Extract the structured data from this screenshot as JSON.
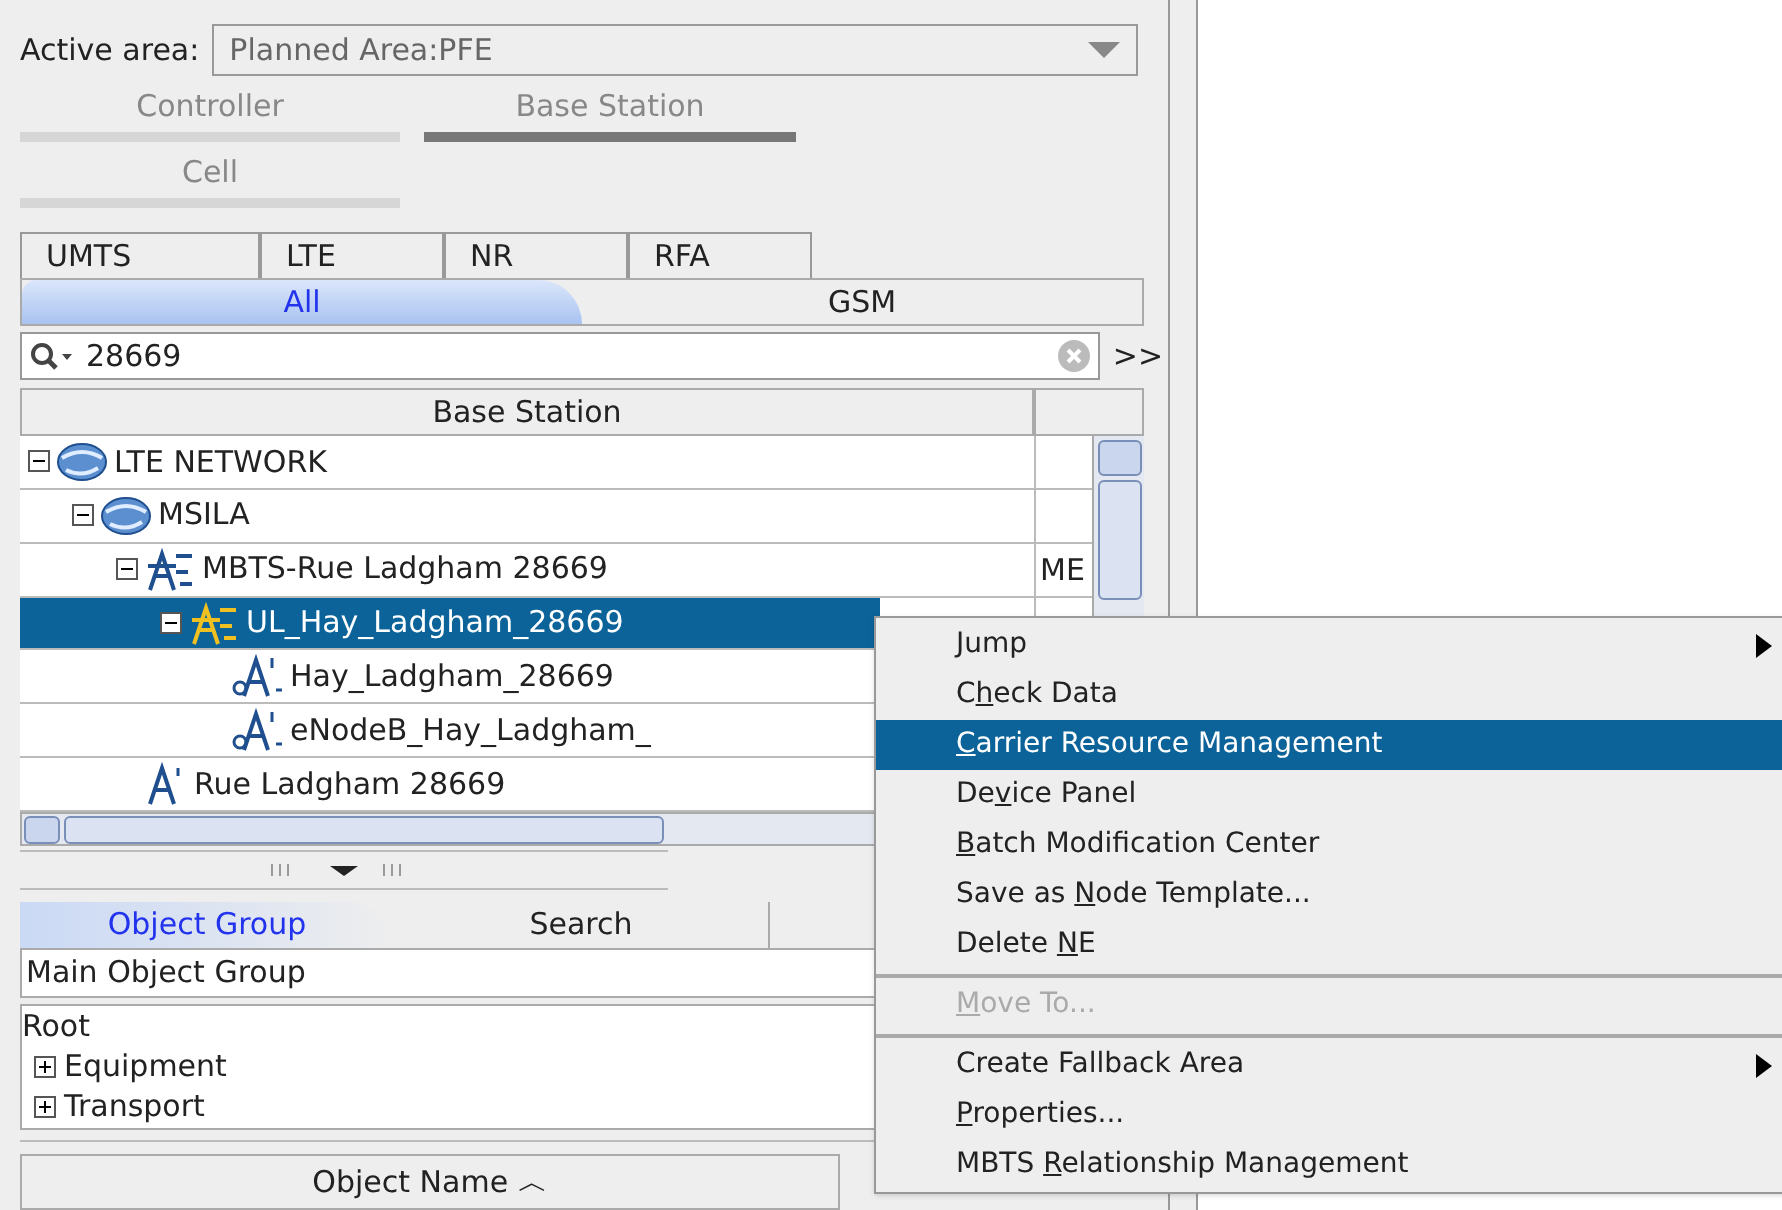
{
  "active_area": {
    "label": "Active area:",
    "value": "Planned Area:PFE"
  },
  "view_tabs": [
    {
      "label": "Controller",
      "selected": false
    },
    {
      "label": "Base Station",
      "selected": true
    },
    {
      "label": "Cell",
      "selected": false
    }
  ],
  "network_tabs": [
    {
      "label": "UMTS"
    },
    {
      "label": "LTE"
    },
    {
      "label": "NR"
    },
    {
      "label": "RFA"
    }
  ],
  "filter_tabs": [
    {
      "label": "All",
      "selected": true
    },
    {
      "label": "GSM",
      "selected": false
    }
  ],
  "search": {
    "value": "28669",
    "more": ">>"
  },
  "table": {
    "columns": [
      "Base Station"
    ],
    "rows": [
      {
        "label": "LTE NETWORK",
        "kind": "network",
        "expanded": true,
        "selected": false,
        "children": [
          {
            "label": "MSILA",
            "kind": "network",
            "expanded": true,
            "selected": false,
            "children": [
              {
                "label": "MBTS-Rue Ladgham 28669",
                "kind": "mbts",
                "expanded": true,
                "selected": false,
                "column_2": "ME",
                "children": [
                  {
                    "label": "UL_Hay_Ladgham_28669",
                    "kind": "mbts",
                    "expanded": true,
                    "selected": true,
                    "children": [
                      {
                        "label": "Hay_Ladgham_28669",
                        "kind": "nodeb",
                        "selected": false
                      },
                      {
                        "label": "eNodeB_Hay_Ladgham_",
                        "kind": "nodeb",
                        "selected": false
                      }
                    ]
                  }
                ]
              },
              {
                "label": "Rue Ladgham 28669",
                "kind": "station",
                "selected": false
              }
            ]
          }
        ]
      }
    ]
  },
  "group_tabs": [
    {
      "label": "Object Group",
      "selected": true
    },
    {
      "label": "Search",
      "selected": false
    }
  ],
  "group_field": {
    "value": "Main Object Group"
  },
  "group_tree": {
    "label": "Root",
    "children": [
      {
        "label": "Equipment",
        "expanded": false
      },
      {
        "label": "Transport",
        "expanded": false
      }
    ]
  },
  "object_table": {
    "columns": [
      "Object Name ︿"
    ]
  },
  "context_menu": [
    {
      "kind": "item",
      "pre": "Jump",
      "selected": false,
      "disabled": false,
      "submenu": true
    },
    {
      "kind": "item",
      "pre": "C",
      "key": "h",
      "post": "eck Data",
      "selected": false,
      "disabled": false,
      "submenu": false
    },
    {
      "kind": "item",
      "key": "C",
      "post": "arrier Resource Management",
      "selected": true,
      "disabled": false,
      "submenu": false
    },
    {
      "kind": "item",
      "pre": "De",
      "key": "v",
      "post": "ice Panel",
      "selected": false,
      "disabled": false,
      "submenu": false
    },
    {
      "kind": "item",
      "key": "B",
      "post": "atch Modification Center",
      "selected": false,
      "disabled": false,
      "submenu": false
    },
    {
      "kind": "item",
      "pre": "Save as ",
      "key": "N",
      "post": "ode Template...",
      "selected": false,
      "disabled": false,
      "submenu": false
    },
    {
      "kind": "item",
      "pre": "Delete ",
      "key": "N",
      "post": "E",
      "selected": false,
      "disabled": false,
      "submenu": false
    },
    {
      "kind": "separator"
    },
    {
      "kind": "item",
      "key": "M",
      "post": "ove To...",
      "selected": false,
      "disabled": true,
      "submenu": false
    },
    {
      "kind": "separator"
    },
    {
      "kind": "item",
      "pre": "Create Fallback Area",
      "selected": false,
      "disabled": false,
      "submenu": true
    },
    {
      "kind": "item",
      "key": "P",
      "post": "roperties...",
      "selected": false,
      "disabled": false,
      "submenu": false
    },
    {
      "kind": "item",
      "pre": "MBTS ",
      "key": "R",
      "post": "elationship Management",
      "selected": false,
      "disabled": false,
      "submenu": false
    }
  ]
}
